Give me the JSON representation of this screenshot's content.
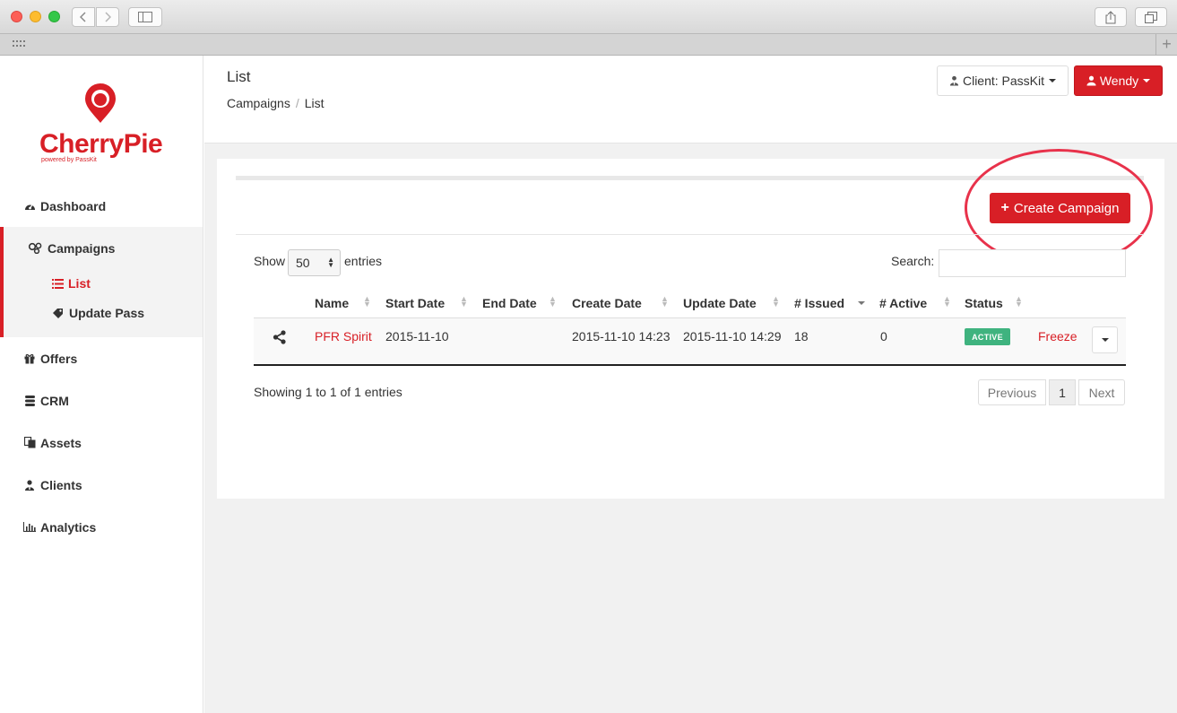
{
  "browser": {
    "back_icon": "chevron-left-icon",
    "forward_icon": "chevron-right-icon",
    "sidebar_icon": "sidebar-toggle-icon",
    "share_icon": "share-icon",
    "tabs_icon": "tabs-overview-icon",
    "new_tab": "+"
  },
  "brand": {
    "name": "CherryPie",
    "tagline": "powered by PassKit",
    "color": "#d81f26"
  },
  "sidebar": {
    "items": [
      {
        "label": "Dashboard",
        "icon": "dashboard-icon"
      },
      {
        "label": "Campaigns",
        "icon": "campaigns-icon"
      },
      {
        "label": "Offers",
        "icon": "gift-icon"
      },
      {
        "label": "CRM",
        "icon": "database-icon"
      },
      {
        "label": "Assets",
        "icon": "files-icon"
      },
      {
        "label": "Clients",
        "icon": "users-icon"
      },
      {
        "label": "Analytics",
        "icon": "bar-chart-icon"
      }
    ],
    "campaigns_sub": [
      {
        "label": "List",
        "icon": "list-icon",
        "active": true
      },
      {
        "label": "Update Pass",
        "icon": "tag-icon",
        "active": false
      }
    ]
  },
  "header": {
    "title": "List",
    "breadcrumb": [
      "Campaigns",
      "List"
    ],
    "client_button": "Client: PassKit",
    "user_button": "Wendy"
  },
  "toolbar": {
    "create_label": "Create Campaign"
  },
  "table_controls": {
    "show_label": "Show",
    "page_length": "50",
    "entries_label": "entries",
    "search_label": "Search:",
    "search_value": ""
  },
  "table": {
    "columns": [
      "Name",
      "Start Date",
      "End Date",
      "Create Date",
      "Update Date",
      "# Issued",
      "# Active",
      "Status"
    ],
    "rows": [
      {
        "name": "PFR Spirit",
        "start_date": "2015-11-10",
        "end_date": "",
        "create_date": "2015-11-10 14:23",
        "update_date": "2015-11-10 14:29",
        "issued": "18",
        "active": "0",
        "status": "ACTIVE",
        "action": "Freeze"
      }
    ]
  },
  "pagination": {
    "info": "Showing 1 to 1 of 1 entries",
    "previous": "Previous",
    "current_page": "1",
    "next": "Next"
  }
}
